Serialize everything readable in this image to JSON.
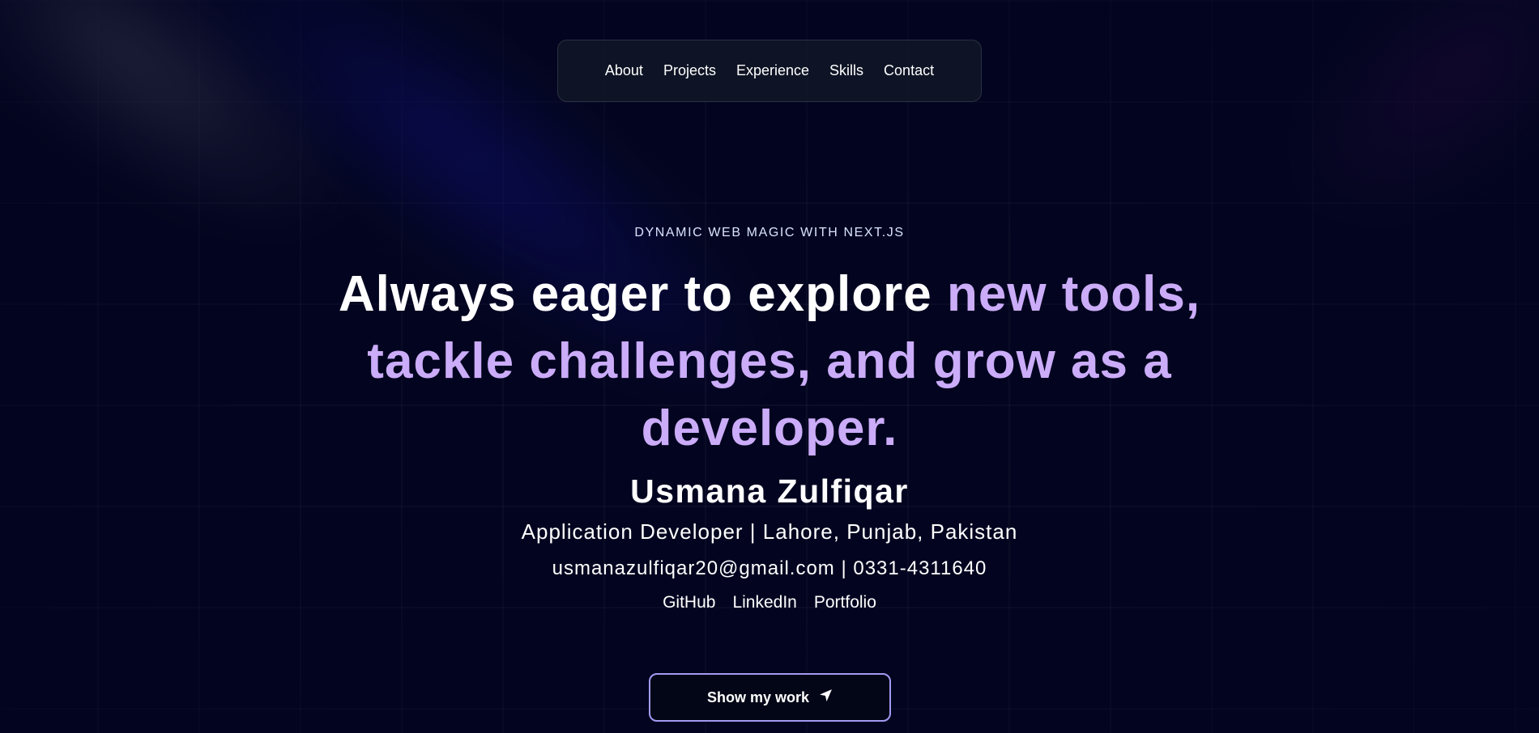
{
  "nav": {
    "items": [
      {
        "label": "About"
      },
      {
        "label": "Projects"
      },
      {
        "label": "Experience"
      },
      {
        "label": "Skills"
      },
      {
        "label": "Contact"
      }
    ]
  },
  "hero": {
    "eyebrow": "DYNAMIC WEB MAGIC WITH NEXT.JS",
    "headline_plain": "Always eager to explore ",
    "headline_accent": "new tools, tackle challenges, and grow as a developer.",
    "name": "Usmana Zulfiqar",
    "role": "Application Developer | Lahore, Punjab, Pakistan",
    "contact": "usmanazulfiqar20@gmail.com | 0331-4311640",
    "links": [
      {
        "label": "GitHub"
      },
      {
        "label": "LinkedIn"
      },
      {
        "label": "Portfolio"
      }
    ],
    "cta_label": "Show my work",
    "cta_icon": "location-arrow-icon"
  },
  "colors": {
    "background": "#030520",
    "accent": "#cbacf9",
    "button_border": "#a29af2"
  }
}
